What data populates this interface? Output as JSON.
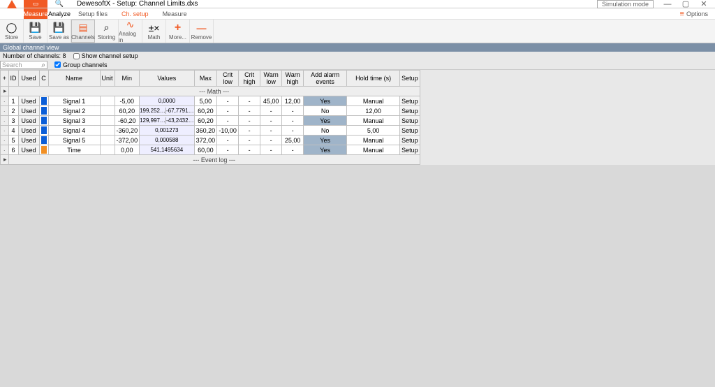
{
  "window": {
    "title": "DewesoftX - Setup: Channel Limits.dxs",
    "sim_mode": "Simulation mode"
  },
  "top_tabs": {
    "measure": "Measure",
    "analyze": "Analyze",
    "setup_files": "Setup files",
    "ch_setup": "Ch. setup",
    "measure2": "Measure",
    "options": "Options"
  },
  "toolbar": {
    "store": "Store",
    "save": "Save",
    "save_as": "Save as",
    "channels": "Channels",
    "storing": "Storing",
    "analog_in": "Analog in",
    "math": "Math",
    "more": "More...",
    "remove": "Remove"
  },
  "global_header": "Global channel view",
  "controls": {
    "num_label": "Number of channels: 8",
    "show_setup": "Show channel setup",
    "search_ph": "Search",
    "group_channels": "Group channels"
  },
  "cols": {
    "plus": "+",
    "id": "ID",
    "used": "Used",
    "c": "C",
    "name": "Name",
    "unit": "Unit",
    "min": "Min",
    "values": "Values",
    "max": "Max",
    "crt_low": "Crit low",
    "crt_high": "Crit high",
    "warn_low": "Warn low",
    "warn_high": "Warn high",
    "alarm": "Add alarm events",
    "hold": "Hold time (s)",
    "setup": "Setup"
  },
  "sections": {
    "math": "--- Math ---",
    "event": "--- Event log ---"
  },
  "rows": [
    {
      "id": "1",
      "used": "Used",
      "color": "#0b5ed7",
      "name": "Signal 1",
      "unit": "",
      "min": "-5,00",
      "value_a": "0,0000",
      "value_b": "",
      "max": "5,00",
      "cl": "-",
      "ch": "-",
      "wl": "45,00",
      "wh": "12,00",
      "alarm": "Yes",
      "hold": "Manual",
      "setup": "Setup"
    },
    {
      "id": "2",
      "used": "Used",
      "color": "#0b5ed7",
      "name": "Signal 2",
      "unit": "",
      "min": "60,20",
      "value_a": "199,252…",
      "value_b": "-67,7791…",
      "max": "60,20",
      "cl": "-",
      "ch": "-",
      "wl": "-",
      "wh": "-",
      "alarm": "No",
      "hold": "12,00",
      "setup": "Setup"
    },
    {
      "id": "3",
      "used": "Used",
      "color": "#0b5ed7",
      "name": "Signal 3",
      "unit": "",
      "min": "-60,20",
      "value_a": "129,997…",
      "value_b": "-43,2432…",
      "max": "60,20",
      "cl": "-",
      "ch": "-",
      "wl": "-",
      "wh": "-",
      "alarm": "Yes",
      "hold": "Manual",
      "setup": "Setup"
    },
    {
      "id": "4",
      "used": "Used",
      "color": "#0b5ed7",
      "name": "Signal 4",
      "unit": "",
      "min": "-360,20",
      "value_a": "0,001273",
      "value_b": "",
      "max": "360,20",
      "cl": "-10,00",
      "ch": "-",
      "wl": "-",
      "wh": "-",
      "alarm": "No",
      "hold": "5,00",
      "setup": "Setup"
    },
    {
      "id": "5",
      "used": "Used",
      "color": "#0b5ed7",
      "name": "Signal 5",
      "unit": "",
      "min": "-372,00",
      "value_a": "0,000588",
      "value_b": "",
      "max": "372,00",
      "cl": "-",
      "ch": "-",
      "wl": "-",
      "wh": "25,00",
      "alarm": "Yes",
      "hold": "Manual",
      "setup": "Setup"
    },
    {
      "id": "6",
      "used": "Used",
      "color": "#f18f24",
      "name": "Time",
      "unit": "",
      "min": "0,00",
      "value_a": "541,1495634",
      "value_b": "",
      "max": "60,00",
      "cl": "-",
      "ch": "-",
      "wl": "-",
      "wh": "-",
      "alarm": "Yes",
      "hold": "Manual",
      "setup": "Setup"
    }
  ]
}
